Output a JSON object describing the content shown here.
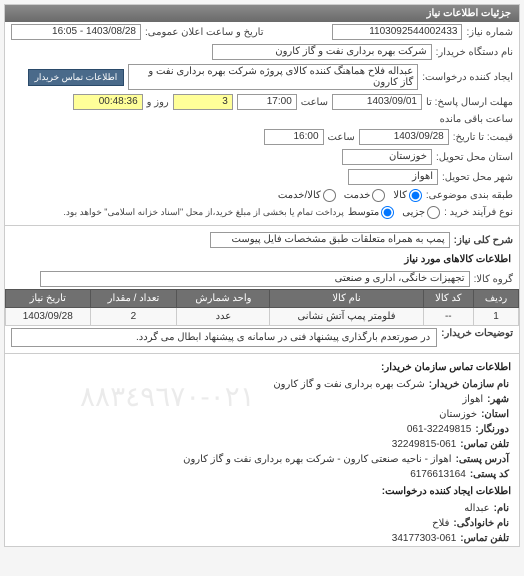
{
  "panel": {
    "title": "جزئیات اطلاعات نیاز"
  },
  "top": {
    "need_no_label": "شماره نیاز:",
    "need_no": "1103092544002433",
    "announce_label": "تاریخ و ساعت اعلان عمومی:",
    "announce": "1403/08/28 - 16:05",
    "buyer_label": "نام دستگاه خریدار:",
    "buyer": "شرکت بهره برداری نفت و گاز کارون",
    "creator_label": "ایجاد کننده درخواست:",
    "creator": "عبداله فلاح هماهنگ کننده کالای پروژه شرکت بهره برداری نفت و گاز کارون",
    "contact_btn": "اطلاعات تماس خریدار",
    "reply_until_label": "مهلت ارسال پاسخ: تا",
    "reply_date": "1403/09/01",
    "time_label": "ساعت",
    "reply_time": "17:00",
    "days_label": "",
    "days": "3",
    "days_unit": "روز و",
    "countdown": "00:48:36",
    "remaining": "ساعت باقی مانده",
    "price_until_label": "قیمت: تا تاریخ:",
    "price_date": "1403/09/28",
    "price_time": "16:00",
    "province_label": "استان محل تحویل:",
    "province": "خوزستان",
    "city_label": "شهر محل تحویل:",
    "city": "اهواز",
    "subject_type_label": "طبقه بندی موضوعی:",
    "r_goods": "کالا",
    "r_service": "خدمت",
    "r_both": "کالا/خدمت",
    "buy_type_label": "نوع فرآیند خرید :",
    "r_partial": "جزیی",
    "r_medium": "متوسط",
    "buy_note": "پرداخت تمام یا بخشی از مبلغ خرید،از محل \"اسناد خزانه اسلامی\" خواهد بود."
  },
  "need": {
    "title_label": "شرح کلی نیاز:",
    "title": "پمپ به همراه متعلقات طبق مشخصات فایل پیوست"
  },
  "goods": {
    "section": "اطلاعات کالاهای مورد نیاز",
    "group_label": "گروه کالا:",
    "group": "تجهیزات خانگی، اداری و صنعتی",
    "headers": {
      "row": "ردیف",
      "code": "کد کالا",
      "name": "نام کالا",
      "unit": "واحد شمارش",
      "qty": "تعداد / مقدار",
      "date": "تاریخ نیاز"
    },
    "rows": [
      {
        "row": "1",
        "code": "--",
        "name": "فلومتر پمپ آتش نشانی",
        "unit": "عدد",
        "qty": "2",
        "date": "1403/09/28"
      }
    ]
  },
  "buyer_note": {
    "label": "توضیحات خریدار:",
    "text": "در صورتعدم بارگذاری پیشنهاد فنی در سامانه ی پیشنهاد ابطال می گردد."
  },
  "contact": {
    "section": "اطلاعات تماس سازمان خریدار:",
    "org_label": "نام سازمان خریدار:",
    "org": "شرکت بهره برداری نفت و گاز کارون",
    "city_label": "شهر:",
    "city": "اهواز",
    "province_label": "استان:",
    "province": "خوزستان",
    "fax_label": "دورنگار:",
    "fax": "061-32249815",
    "phone_label": "تلفن تماس:",
    "phone": "32249815-061",
    "address_label": "آدرس پستی:",
    "address": "اهواز - ناحیه صنعتی کارون - شرکت بهره برداری نفت و گاز کارون",
    "postcode_label": "کد پستی:",
    "postcode": "6176613164",
    "creator_section": "اطلاعات ایجاد کننده درخواست:",
    "fname_label": "نام:",
    "fname": "عبداله",
    "lname_label": "نام خانوادگی:",
    "lname": "فلاح",
    "cphone_label": "تلفن تماس:",
    "cphone": "34177303-061"
  },
  "watermark": "٠٢١-٨٨٣٤٩٦٧٠"
}
